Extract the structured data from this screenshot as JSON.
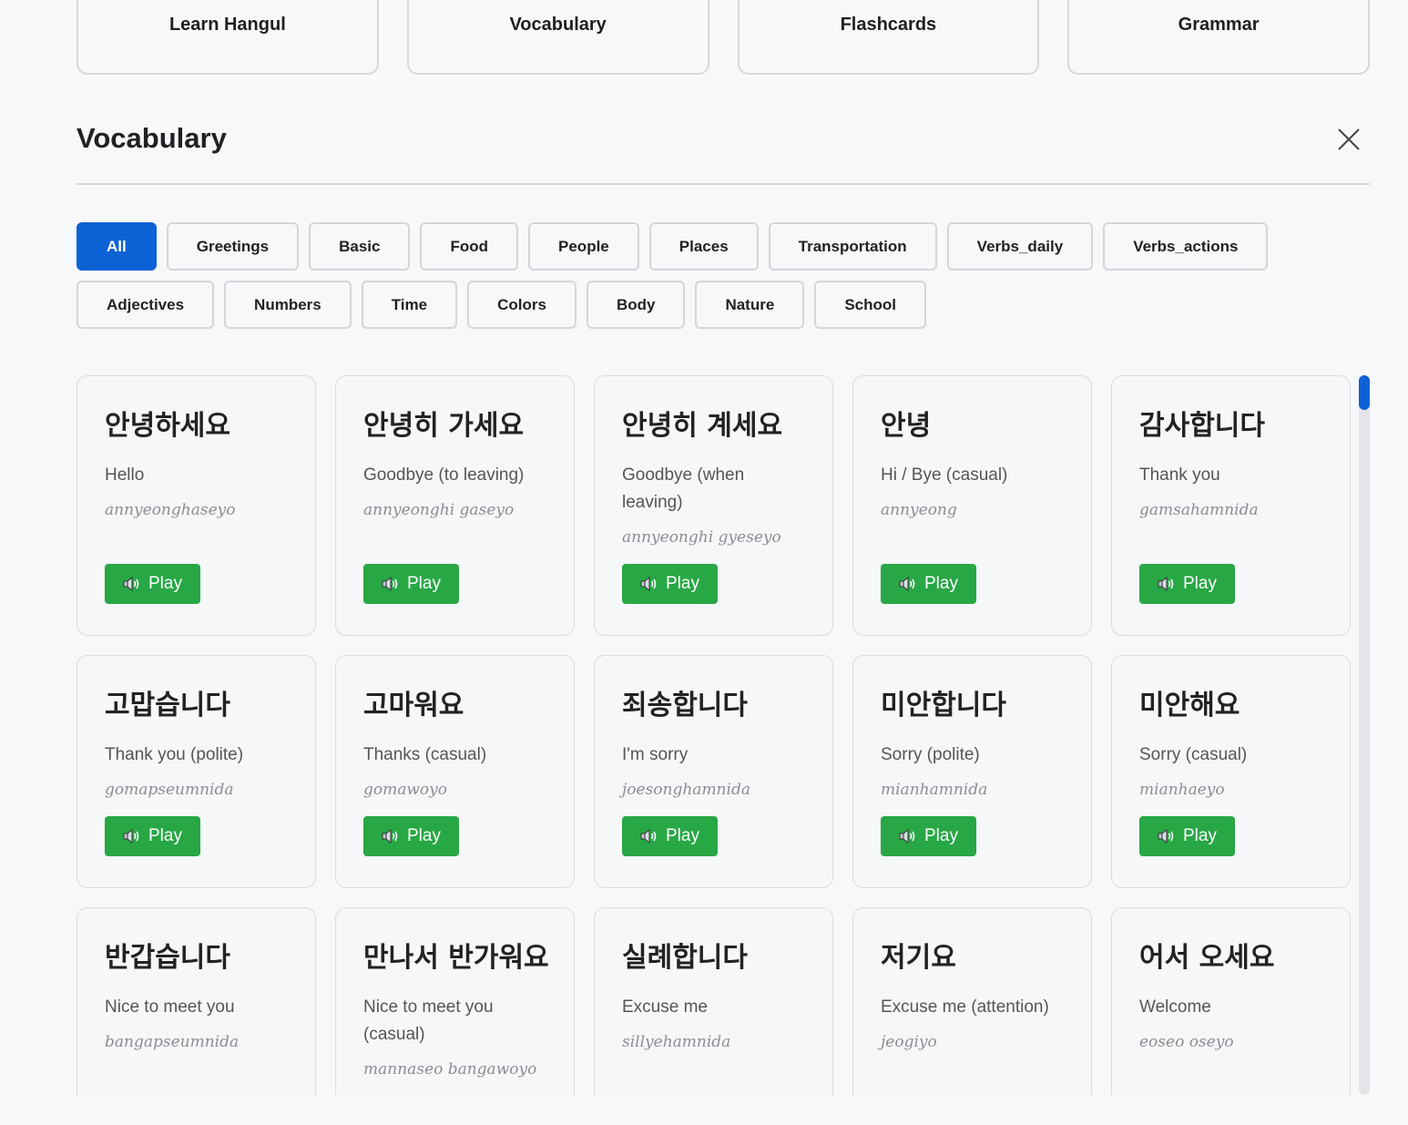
{
  "top_nav": [
    "Learn Hangul",
    "Vocabulary",
    "Flashcards",
    "Grammar"
  ],
  "section": {
    "title": "Vocabulary"
  },
  "filters": [
    {
      "label": "All",
      "active": true
    },
    {
      "label": "Greetings"
    },
    {
      "label": "Basic"
    },
    {
      "label": "Food"
    },
    {
      "label": "People"
    },
    {
      "label": "Places"
    },
    {
      "label": "Transportation"
    },
    {
      "label": "Verbs_daily"
    },
    {
      "label": "Verbs_actions"
    },
    {
      "label": "Adjectives"
    },
    {
      "label": "Numbers"
    },
    {
      "label": "Time"
    },
    {
      "label": "Colors"
    },
    {
      "label": "Body"
    },
    {
      "label": "Nature"
    },
    {
      "label": "School"
    }
  ],
  "play_label": "Play",
  "cards": [
    {
      "korean": "안녕하세요",
      "english": "Hello",
      "roman": "annyeonghaseyo"
    },
    {
      "korean": "안녕히 가세요",
      "english": "Goodbye (to leaving)",
      "roman": "annyeonghi gaseyo"
    },
    {
      "korean": "안녕히 계세요",
      "english": "Goodbye (when leaving)",
      "roman": "annyeonghi gyeseyo"
    },
    {
      "korean": "안녕",
      "english": "Hi / Bye (casual)",
      "roman": "annyeong"
    },
    {
      "korean": "감사합니다",
      "english": "Thank you",
      "roman": "gamsahamnida"
    },
    {
      "korean": "고맙습니다",
      "english": "Thank you (polite)",
      "roman": "gomapseumnida"
    },
    {
      "korean": "고마워요",
      "english": "Thanks (casual)",
      "roman": "gomawoyo"
    },
    {
      "korean": "죄송합니다",
      "english": "I'm sorry",
      "roman": "joesonghamnida"
    },
    {
      "korean": "미안합니다",
      "english": "Sorry (polite)",
      "roman": "mianhamnida"
    },
    {
      "korean": "미안해요",
      "english": "Sorry (casual)",
      "roman": "mianhaeyo"
    },
    {
      "korean": "반갑습니다",
      "english": "Nice to meet you",
      "roman": "bangapseumnida"
    },
    {
      "korean": "만나서 반가워요",
      "english": "Nice to meet you (casual)",
      "roman": "mannaseo bangawoyo"
    },
    {
      "korean": "실례합니다",
      "english": "Excuse me",
      "roman": "sillyehamnida"
    },
    {
      "korean": "저기요",
      "english": "Excuse me (attention)",
      "roman": "jeogiyo"
    },
    {
      "korean": "어서 오세요",
      "english": "Welcome",
      "roman": "eoseo oseyo"
    }
  ],
  "colors": {
    "accent": "#0d62d6",
    "play": "#28a745"
  }
}
